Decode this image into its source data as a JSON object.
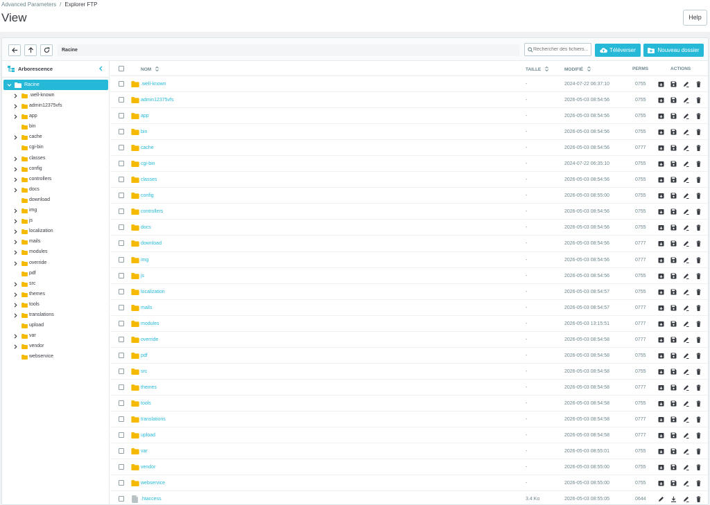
{
  "breadcrumb": {
    "parent": "Advanced Parameters",
    "separator": "/",
    "current": "Explorer FTP"
  },
  "page_title": "View",
  "help_label": "Help",
  "toolbar": {
    "path": "Racine",
    "search_placeholder": "Rechercher des fichiers...",
    "upload_label": "Téléverser",
    "new_folder_label": "Nouveau dossier"
  },
  "sidebar": {
    "title": "Arborescence",
    "root": "Racine",
    "items": [
      {
        "label": ".well-known",
        "expandable": true
      },
      {
        "label": "admin12375vfs",
        "expandable": true
      },
      {
        "label": "app",
        "expandable": true
      },
      {
        "label": "bin",
        "expandable": false
      },
      {
        "label": "cache",
        "expandable": true
      },
      {
        "label": "cgi-bin",
        "expandable": false
      },
      {
        "label": "classes",
        "expandable": true
      },
      {
        "label": "config",
        "expandable": true
      },
      {
        "label": "controllers",
        "expandable": true
      },
      {
        "label": "docs",
        "expandable": true
      },
      {
        "label": "download",
        "expandable": false
      },
      {
        "label": "img",
        "expandable": true
      },
      {
        "label": "js",
        "expandable": true
      },
      {
        "label": "localization",
        "expandable": true
      },
      {
        "label": "mails",
        "expandable": true
      },
      {
        "label": "modules",
        "expandable": true
      },
      {
        "label": "override",
        "expandable": true
      },
      {
        "label": "pdf",
        "expandable": false
      },
      {
        "label": "src",
        "expandable": true
      },
      {
        "label": "themes",
        "expandable": true
      },
      {
        "label": "tools",
        "expandable": true
      },
      {
        "label": "translations",
        "expandable": true
      },
      {
        "label": "upload",
        "expandable": false
      },
      {
        "label": "var",
        "expandable": true
      },
      {
        "label": "vendor",
        "expandable": true
      },
      {
        "label": "webservice",
        "expandable": false
      }
    ]
  },
  "table": {
    "headers": {
      "name": "NOM",
      "size": "TAILLE",
      "modified": "MODIFIÉ",
      "perms": "PERMS",
      "actions": "ACTIONS"
    },
    "rows": [
      {
        "name": ".well-known",
        "type": "folder",
        "size": "-",
        "modified": "2024-07-22 06:37:10",
        "perms": "0755"
      },
      {
        "name": "admin12375vfs",
        "type": "folder",
        "size": "-",
        "modified": "2026-05-03 08:54:56",
        "perms": "0755"
      },
      {
        "name": "app",
        "type": "folder",
        "size": "-",
        "modified": "2026-05-03 08:54:56",
        "perms": "0755"
      },
      {
        "name": "bin",
        "type": "folder",
        "size": "-",
        "modified": "2026-05-03 08:54:56",
        "perms": "0755"
      },
      {
        "name": "cache",
        "type": "folder",
        "size": "-",
        "modified": "2026-05-03 08:54:56",
        "perms": "0777"
      },
      {
        "name": "cgi-bin",
        "type": "folder",
        "size": "-",
        "modified": "2024-07-22 06:35:10",
        "perms": "0755"
      },
      {
        "name": "classes",
        "type": "folder",
        "size": "-",
        "modified": "2026-05-03 08:54:56",
        "perms": "0755"
      },
      {
        "name": "config",
        "type": "folder",
        "size": "-",
        "modified": "2026-05-03 08:55:00",
        "perms": "0755"
      },
      {
        "name": "controllers",
        "type": "folder",
        "size": "-",
        "modified": "2026-05-03 08:54:56",
        "perms": "0755"
      },
      {
        "name": "docs",
        "type": "folder",
        "size": "-",
        "modified": "2026-05-03 08:54:56",
        "perms": "0755"
      },
      {
        "name": "download",
        "type": "folder",
        "size": "-",
        "modified": "2026-05-03 08:54:56",
        "perms": "0777"
      },
      {
        "name": "img",
        "type": "folder",
        "size": "-",
        "modified": "2026-05-03 08:54:56",
        "perms": "0777"
      },
      {
        "name": "js",
        "type": "folder",
        "size": "-",
        "modified": "2026-05-03 08:54:56",
        "perms": "0755"
      },
      {
        "name": "localization",
        "type": "folder",
        "size": "-",
        "modified": "2026-05-03 08:54:57",
        "perms": "0755"
      },
      {
        "name": "mails",
        "type": "folder",
        "size": "-",
        "modified": "2026-05-03 08:54:57",
        "perms": "0777"
      },
      {
        "name": "modules",
        "type": "folder",
        "size": "-",
        "modified": "2026-05-03 13:15:51",
        "perms": "0777"
      },
      {
        "name": "override",
        "type": "folder",
        "size": "-",
        "modified": "2026-05-03 08:54:58",
        "perms": "0777"
      },
      {
        "name": "pdf",
        "type": "folder",
        "size": "-",
        "modified": "2026-05-03 08:54:58",
        "perms": "0755"
      },
      {
        "name": "src",
        "type": "folder",
        "size": "-",
        "modified": "2026-05-03 08:54:58",
        "perms": "0755"
      },
      {
        "name": "themes",
        "type": "folder",
        "size": "-",
        "modified": "2026-05-03 08:54:58",
        "perms": "0777"
      },
      {
        "name": "tools",
        "type": "folder",
        "size": "-",
        "modified": "2026-05-03 08:54:58",
        "perms": "0755"
      },
      {
        "name": "translations",
        "type": "folder",
        "size": "-",
        "modified": "2026-05-03 08:54:58",
        "perms": "0777"
      },
      {
        "name": "upload",
        "type": "folder",
        "size": "-",
        "modified": "2026-05-03 08:54:58",
        "perms": "0777"
      },
      {
        "name": "var",
        "type": "folder",
        "size": "-",
        "modified": "2026-05-03 08:55:01",
        "perms": "0755"
      },
      {
        "name": "vendor",
        "type": "folder",
        "size": "-",
        "modified": "2026-05-03 08:55:00",
        "perms": "0755"
      },
      {
        "name": "webservice",
        "type": "folder",
        "size": "-",
        "modified": "2026-05-03 08:55:00",
        "perms": "0755"
      },
      {
        "name": ".htaccess",
        "type": "file",
        "size": "3.4 Ko",
        "modified": "2026-05-03 08:55:05",
        "perms": "0644"
      }
    ]
  },
  "colors": {
    "accent": "#25b9d7",
    "folder": "#f5b900",
    "file": "#b8c1c4",
    "icon_dark": "#363a41"
  },
  "icons": [
    "back-arrow-icon",
    "up-arrow-icon",
    "refresh-icon",
    "search-icon",
    "cloud-upload-icon",
    "folder-plus-icon",
    "tree-icon",
    "chevron-left-icon",
    "chevron-right-icon",
    "chevron-down-icon",
    "folder-icon",
    "file-icon",
    "sort-icon",
    "archive-icon",
    "save-icon",
    "rename-icon",
    "delete-icon",
    "edit-icon",
    "download-icon"
  ]
}
